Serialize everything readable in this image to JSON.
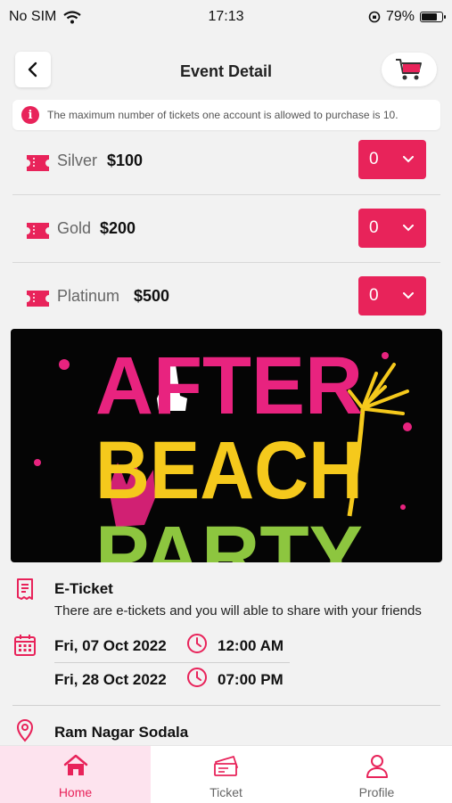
{
  "status_bar": {
    "carrier": "No SIM",
    "time": "17:13",
    "battery": "79%",
    "battery_level": 0.79
  },
  "header": {
    "title": "Event Detail"
  },
  "notice": {
    "text": "The maximum number of tickets one account is allowed to purchase is 10."
  },
  "tickets": [
    {
      "name": "Silver",
      "price": "$100",
      "qty": "0"
    },
    {
      "name": "Gold",
      "price": "$200",
      "qty": "0"
    },
    {
      "name": "Platinum",
      "price": "$500",
      "qty": "0"
    }
  ],
  "banner": {
    "lines": [
      "AFTER",
      "BEACH",
      "PARTY"
    ]
  },
  "eticket": {
    "title": "E-Ticket",
    "description": "There are e-tickets and you will able to share with your friends"
  },
  "schedule": [
    {
      "date": "Fri, 07 Oct 2022",
      "time": "12:00 AM"
    },
    {
      "date": "Fri, 28 Oct 2022",
      "time": "07:00 PM"
    }
  ],
  "location": {
    "name": "Ram Nagar Sodala"
  },
  "tabs": [
    {
      "label": "Home",
      "active": true
    },
    {
      "label": "Ticket",
      "active": false
    },
    {
      "label": "Profile",
      "active": false
    }
  ],
  "colors": {
    "accent": "#e8235a",
    "background": "#f2f2f2"
  }
}
